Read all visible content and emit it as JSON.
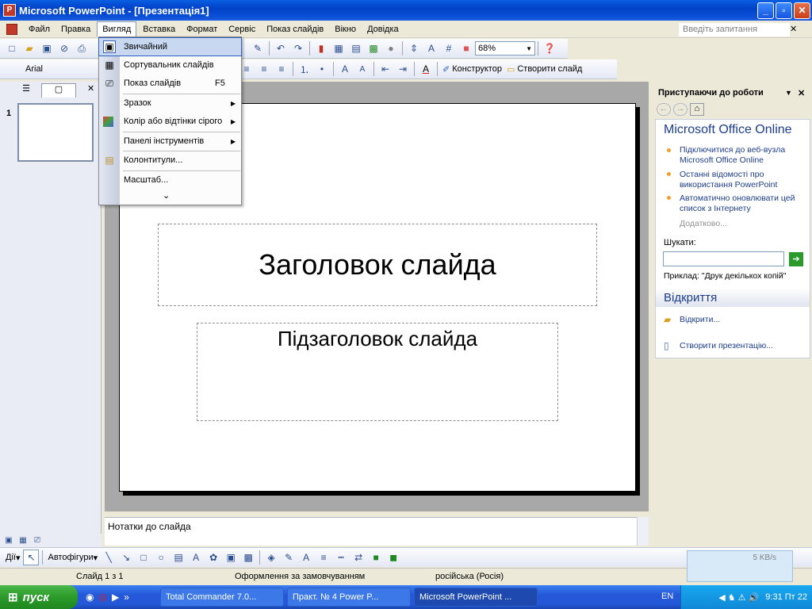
{
  "window": {
    "title": "Microsoft PowerPoint - [Презентація1]",
    "minimize": "_",
    "maximize": "▫",
    "close": "✕"
  },
  "menu": {
    "items": [
      "Файл",
      "Правка",
      "Вигляд",
      "Вставка",
      "Формат",
      "Сервіс",
      "Показ слайдів",
      "Вікно",
      "Довідка"
    ],
    "active_index": 2,
    "ask_placeholder": "Введіть запитання",
    "doc_close": "✕"
  },
  "toolbar": {
    "zoom": "68%",
    "font": "Arial",
    "designer": "Конструктор",
    "new_slide": "Створити слайд"
  },
  "view_menu": {
    "items": [
      {
        "label": "Звичайний",
        "shortcut": "",
        "icon": "normal-view-icon",
        "glyph": "▣",
        "submenu": false
      },
      {
        "label": "Сортувальник слайдів",
        "shortcut": "",
        "icon": "slide-sorter-icon",
        "glyph": "▦",
        "submenu": false
      },
      {
        "label": "Показ слайдів",
        "shortcut": "F5",
        "icon": "slideshow-icon",
        "glyph": "⎚",
        "submenu": false
      },
      {
        "label": "Зразок",
        "shortcut": "",
        "icon": "",
        "glyph": "",
        "submenu": true
      },
      {
        "label": "Колір або відтінки сірого",
        "shortcut": "",
        "icon": "color-icon",
        "glyph": "■",
        "submenu": true
      },
      {
        "label": "Панелі інструментів",
        "shortcut": "",
        "icon": "",
        "glyph": "",
        "submenu": true
      },
      {
        "label": "Колонтитули...",
        "shortcut": "",
        "icon": "header-footer-icon",
        "glyph": "▤",
        "submenu": false
      },
      {
        "label": "Масштаб...",
        "shortcut": "",
        "icon": "",
        "glyph": "",
        "submenu": false
      }
    ],
    "expand": "⌄"
  },
  "left_pane": {
    "tab_outline": "☰",
    "tab_slides": "▢",
    "close": "✕",
    "slide_number": "1"
  },
  "slide": {
    "title": "Заголовок слайда",
    "subtitle": "Підзаголовок слайда"
  },
  "notes": {
    "placeholder": "Нотатки до слайда"
  },
  "task_pane": {
    "header": "Приступаючи до роботи",
    "section_title": "Microsoft Office Online",
    "links": [
      "Підключитися до веб-вузла Microsoft Office Online",
      "Останні відомості про використання PowerPoint",
      "Автоматично оновлювати цей список з Інтернету"
    ],
    "more": "Додатково...",
    "search_label": "Шукати:",
    "search_go": "➔",
    "example": "Приклад:  \"Друк декількох копій\"",
    "open_header": "Відкриття",
    "open_link": "Відкрити...",
    "create_link": "Створити презентацію..."
  },
  "drawing": {
    "actions": "Дії",
    "autoshapes": "Автофігури"
  },
  "status": {
    "slide": "Слайд 1 з 1",
    "design": "Оформлення за замовчуванням",
    "language": "російська (Росія)",
    "net_speed": "5 KB/s"
  },
  "taskbar": {
    "start": "пуск",
    "tasks": [
      "Total Commander 7.0...",
      "Практ. № 4 Power P...",
      "Microsoft PowerPoint ..."
    ],
    "active_task": 2,
    "lang": "EN",
    "clock": "9:31 Пт 22"
  }
}
